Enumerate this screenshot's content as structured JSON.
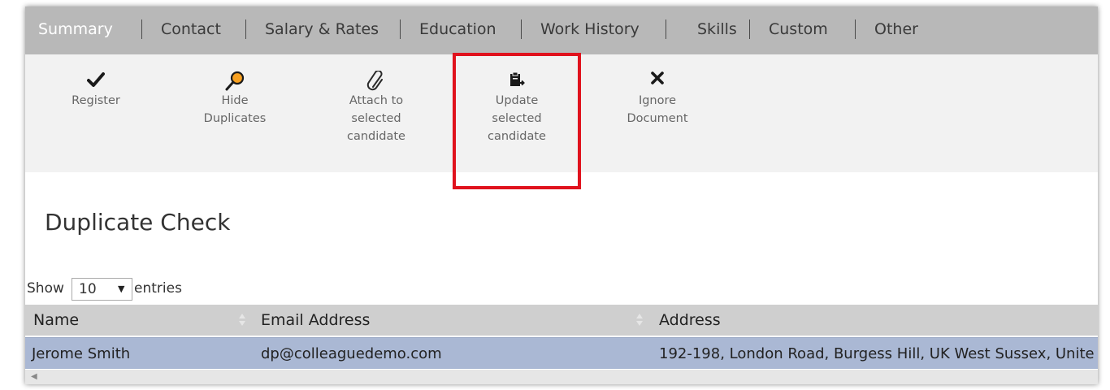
{
  "tabs": [
    {
      "label": "Summary",
      "active": true
    },
    {
      "label": "Contact"
    },
    {
      "label": "Salary & Rates"
    },
    {
      "label": "Education"
    },
    {
      "label": "Work History"
    },
    {
      "label": "Skills"
    },
    {
      "label": "Custom"
    },
    {
      "label": "Other"
    }
  ],
  "toolbar": {
    "register": {
      "icon": "checkmark-icon",
      "label": "Register"
    },
    "hide_duplicates": {
      "icon": "search-icon",
      "label_lines": [
        "Hide",
        "Duplicates"
      ]
    },
    "attach": {
      "icon": "paperclip-icon",
      "label_lines": [
        "Attach to",
        "selected",
        "candidate"
      ]
    },
    "update": {
      "icon": "clipboard-arrow-icon",
      "label_lines": [
        "Update",
        "selected",
        "candidate"
      ]
    },
    "ignore": {
      "icon": "close-icon",
      "label_lines": [
        "Ignore",
        "Document"
      ]
    }
  },
  "page_title": "Duplicate Check",
  "entries": {
    "show_label": "Show",
    "value": "10",
    "entries_label": "entries"
  },
  "table": {
    "columns": [
      "Name",
      "Email Address",
      "Address"
    ],
    "rows": [
      {
        "name": "Jerome Smith",
        "email": "dp@colleaguedemo.com",
        "address": "192-198, London Road, Burgess Hill, UK West Sussex, Unite"
      }
    ]
  },
  "colors": {
    "highlight": "#e0121d",
    "selected_row": "#aab8d4",
    "tabbar": "#b8b8b8"
  }
}
